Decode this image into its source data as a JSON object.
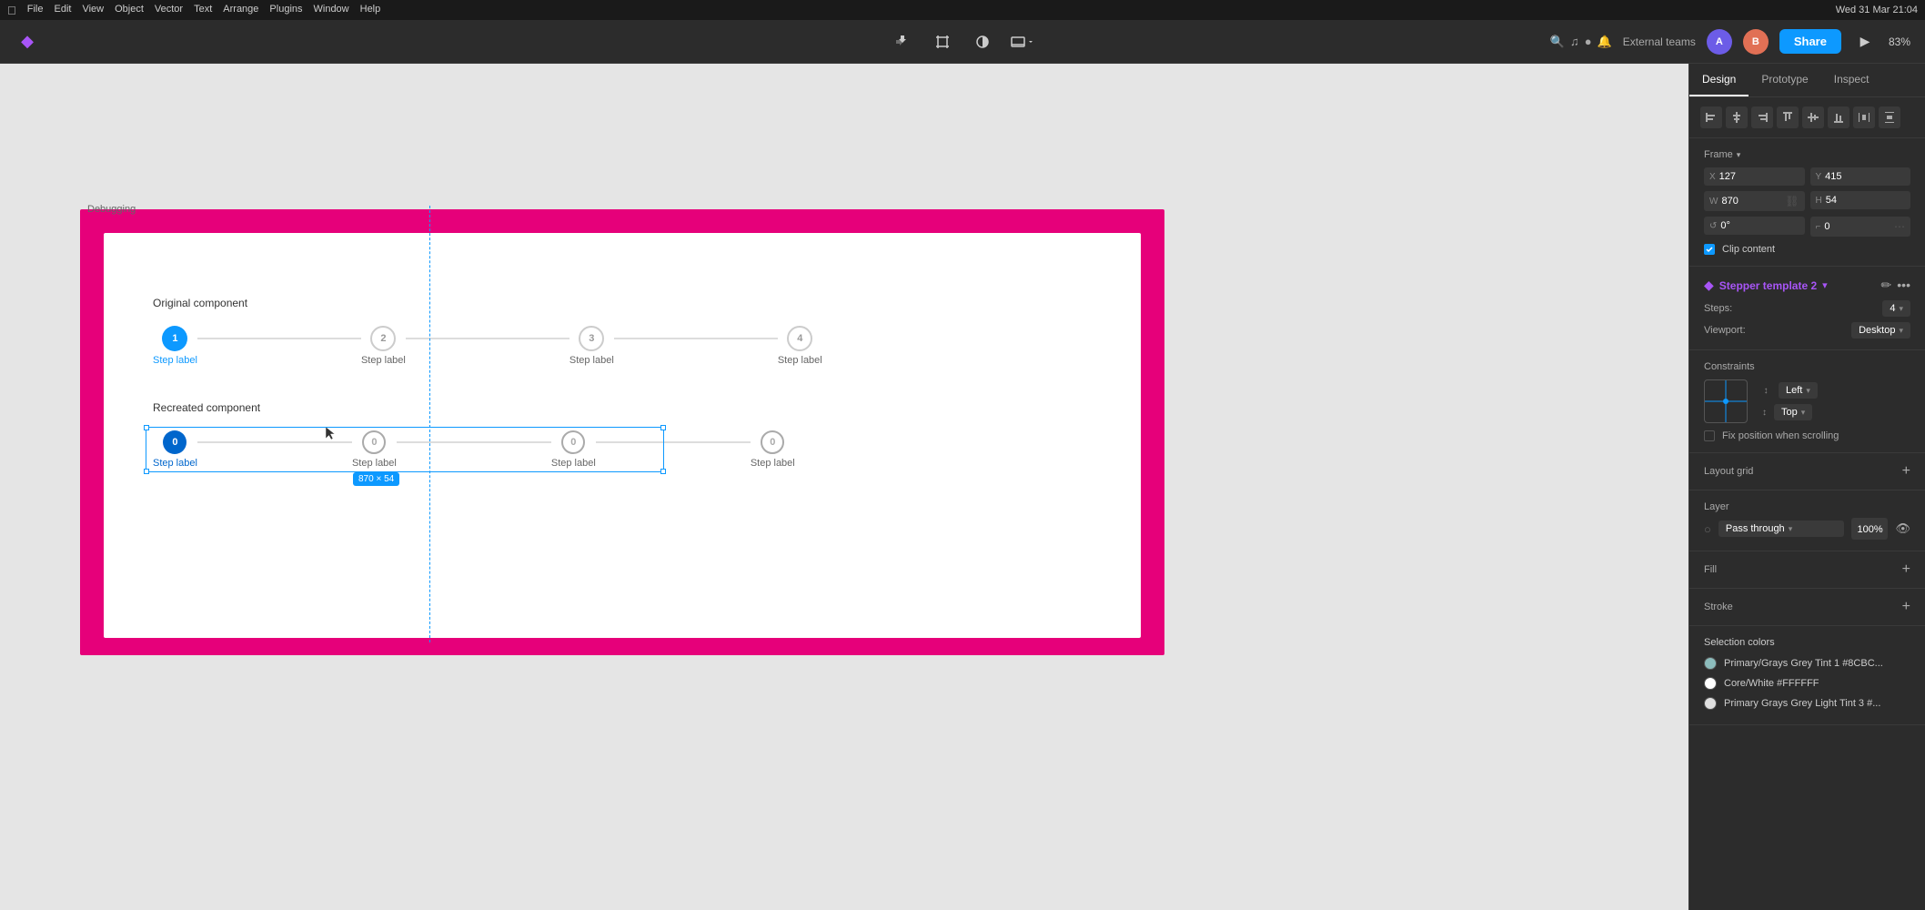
{
  "statusBar": {
    "appName": "Figma",
    "menus": [
      "File",
      "Edit",
      "View",
      "Object",
      "Vector",
      "Text",
      "Arrange",
      "Plugins",
      "Window",
      "Help"
    ],
    "time": "Wed 31 Mar 21:04",
    "zoomLevel": "83%",
    "externalTeams": "External teams"
  },
  "toolbar": {
    "shareLabel": "Share",
    "icons": [
      "move",
      "frame",
      "contrast",
      "viewport"
    ]
  },
  "canvas": {
    "debuggingLabel": "Debugging",
    "pinkFrameBackground": "#e6007a",
    "whiteFrameBackground": "#ffffff",
    "originalComponentLabel": "Original component",
    "recreatedComponentLabel": "Recreated component",
    "stepLabels": [
      "Step label",
      "Step label",
      "Step label",
      "Step label"
    ],
    "sizeBadge": "870 × 54",
    "dashedLineColor": "#0d99ff"
  },
  "rightPanel": {
    "tabs": [
      "Design",
      "Prototype",
      "Inspect"
    ],
    "activeTab": "Design",
    "alignmentTools": [
      "align-left",
      "align-center-h",
      "align-right",
      "align-top",
      "align-center-v",
      "align-bottom",
      "distribute-h",
      "distribute-v"
    ],
    "frame": {
      "title": "Frame",
      "x": "127",
      "y": "415",
      "w": "870",
      "h": "54",
      "rotation": "0°",
      "cornerRadius": "0",
      "clipContent": true,
      "clipContentLabel": "Clip content"
    },
    "component": {
      "name": "Stepper template 2",
      "stepsLabel": "Steps:",
      "stepsValue": "4",
      "viewportLabel": "Viewport:",
      "viewportValue": "Desktop"
    },
    "constraints": {
      "title": "Constraints",
      "horizontal": "Left",
      "vertical": "Top",
      "fixPositionLabel": "Fix position when scrolling"
    },
    "layoutGrid": {
      "title": "Layout grid",
      "addLabel": "+"
    },
    "layer": {
      "title": "Layer",
      "blendMode": "Pass through",
      "opacity": "100%"
    },
    "fill": {
      "title": "Fill"
    },
    "stroke": {
      "title": "Stroke"
    },
    "selectionColors": {
      "title": "Selection colors",
      "colors": [
        {
          "name": "Primary/Grays Grey Tint 1 #8CBC...",
          "hex": "#8cbcbc",
          "swatch": "#8cbcbc"
        },
        {
          "name": "Core/White #FFFFFF",
          "hex": "#FFFFFF",
          "swatch": "#FFFFFF"
        },
        {
          "name": "Primary Grays Grey Light Tint 3 #...",
          "hex": "#e0e0e0",
          "swatch": "#e0e0e0"
        }
      ]
    }
  }
}
